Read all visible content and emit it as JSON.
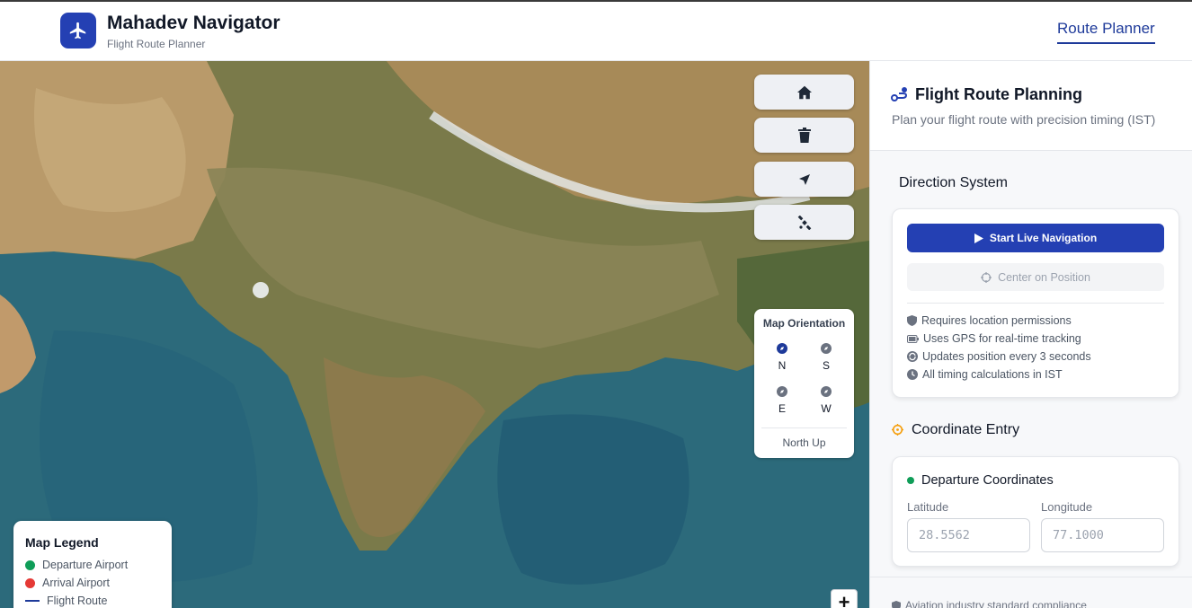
{
  "header": {
    "app_name": "Mahadev Navigator",
    "app_subtitle": "Flight Route Planner",
    "nav_link": "Route Planner",
    "brand_color": "#2440b3"
  },
  "map": {
    "tools": [
      {
        "icon": "home-icon",
        "label": "home"
      },
      {
        "icon": "trash-icon",
        "label": "clear route"
      },
      {
        "icon": "location-arrow-icon",
        "label": "locate"
      },
      {
        "icon": "satellite-icon",
        "label": "satellite"
      }
    ],
    "orientation": {
      "title": "Map Orientation",
      "directions": [
        "N",
        "S",
        "E",
        "W"
      ],
      "current": "North Up"
    },
    "legend": {
      "title": "Map Legend",
      "items": [
        {
          "label": "Departure Airport",
          "color": "#0f9d58"
        },
        {
          "label": "Arrival Airport",
          "color": "#e53935"
        },
        {
          "label": "Flight Route",
          "color": "#1e3a9a"
        }
      ]
    },
    "zoom_in": "+"
  },
  "panel": {
    "title": "Flight Route Planning",
    "subtitle": "Plan your flight route with precision timing (IST)",
    "direction": {
      "title": "Direction System",
      "start_label": "Start Live Navigation",
      "center_label": "Center on Position",
      "notes": [
        "Requires location permissions",
        "Uses GPS for real-time tracking",
        "Updates position every 3 seconds",
        "All timing calculations in IST"
      ]
    },
    "coordinates": {
      "title": "Coordinate Entry",
      "departure_title": "Departure Coordinates",
      "lat_label": "Latitude",
      "lon_label": "Longitude",
      "lat_placeholder": "28.5562",
      "lon_placeholder": "77.1000"
    },
    "footer": "Aviation industry standard compliance"
  }
}
